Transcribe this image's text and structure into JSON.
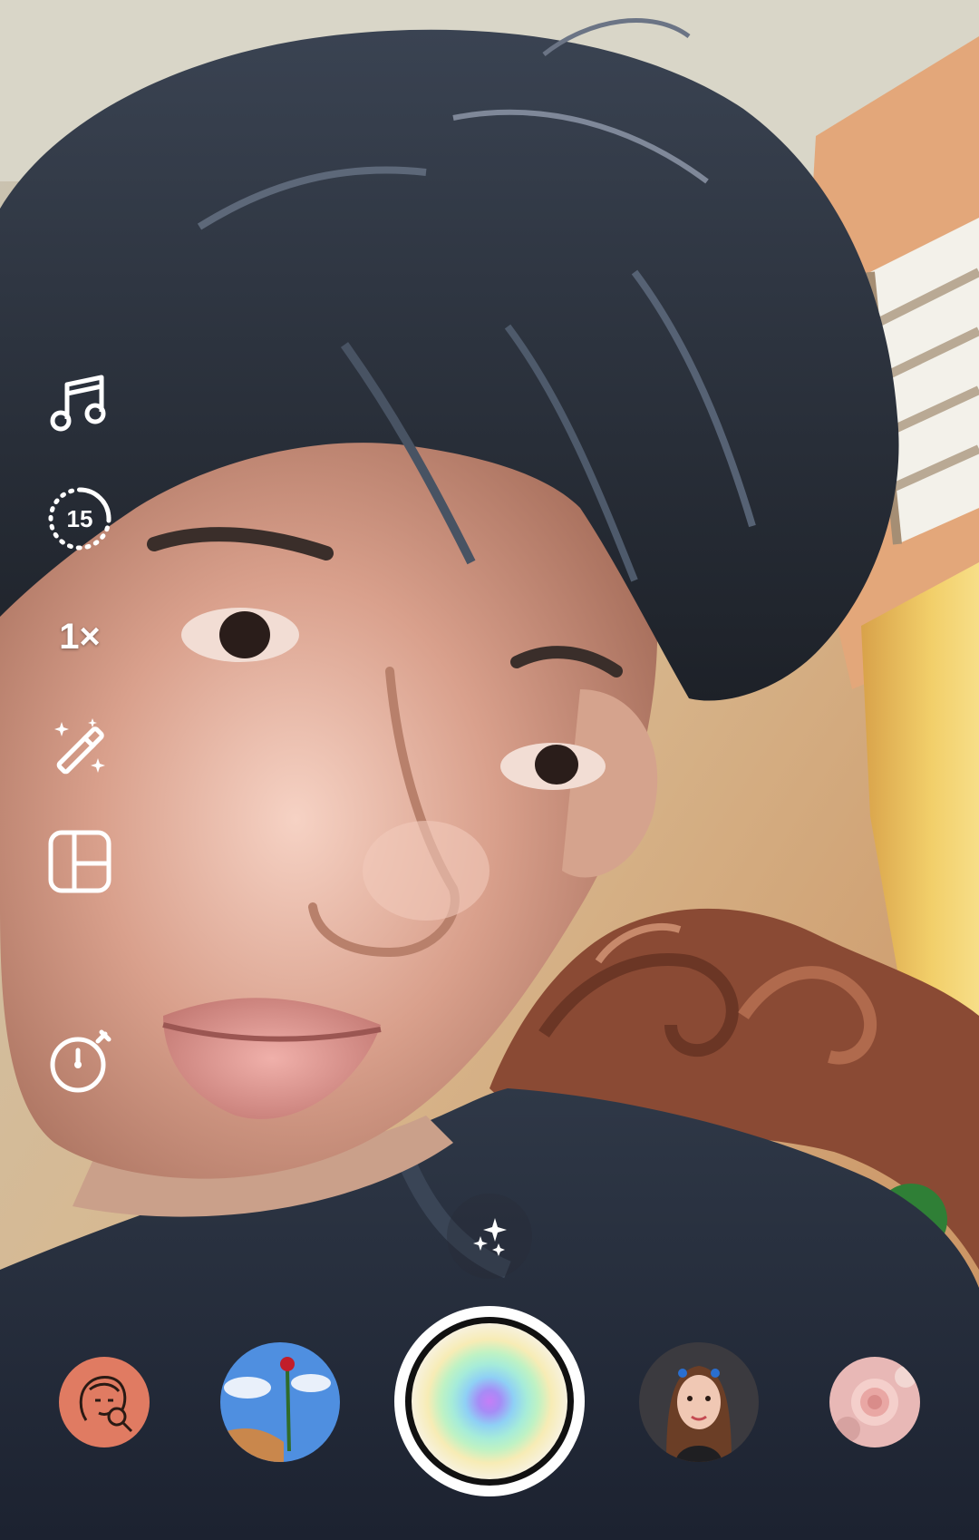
{
  "camera": {
    "tools": [
      {
        "name": "music",
        "icon": "music-note-icon"
      },
      {
        "name": "length",
        "icon": "duration-timer-icon",
        "label": "15"
      },
      {
        "name": "zoom",
        "icon": "zoom-icon",
        "label": "1×"
      },
      {
        "name": "retouch",
        "icon": "magic-wand-icon"
      },
      {
        "name": "layout",
        "icon": "layout-grid-icon"
      },
      {
        "name": "timer",
        "icon": "stopwatch-icon"
      }
    ],
    "effects_button": {
      "icon": "sparkles-icon"
    },
    "effect_tray": [
      {
        "name": "face-retouch-effect",
        "thumb_color": "#e07b62"
      },
      {
        "name": "rose-sky-effect",
        "thumb_color": "#6fa3e8"
      },
      {
        "name": "portrait-effect",
        "thumb_color": "#3b3a3f"
      },
      {
        "name": "pink-rose-effect",
        "thumb_color": "#e8b8b6"
      }
    ],
    "shutter": {
      "icon": "shutter-button"
    },
    "colors": {
      "icon": "#ffffff",
      "accent_shutter": "#c57df7"
    }
  }
}
